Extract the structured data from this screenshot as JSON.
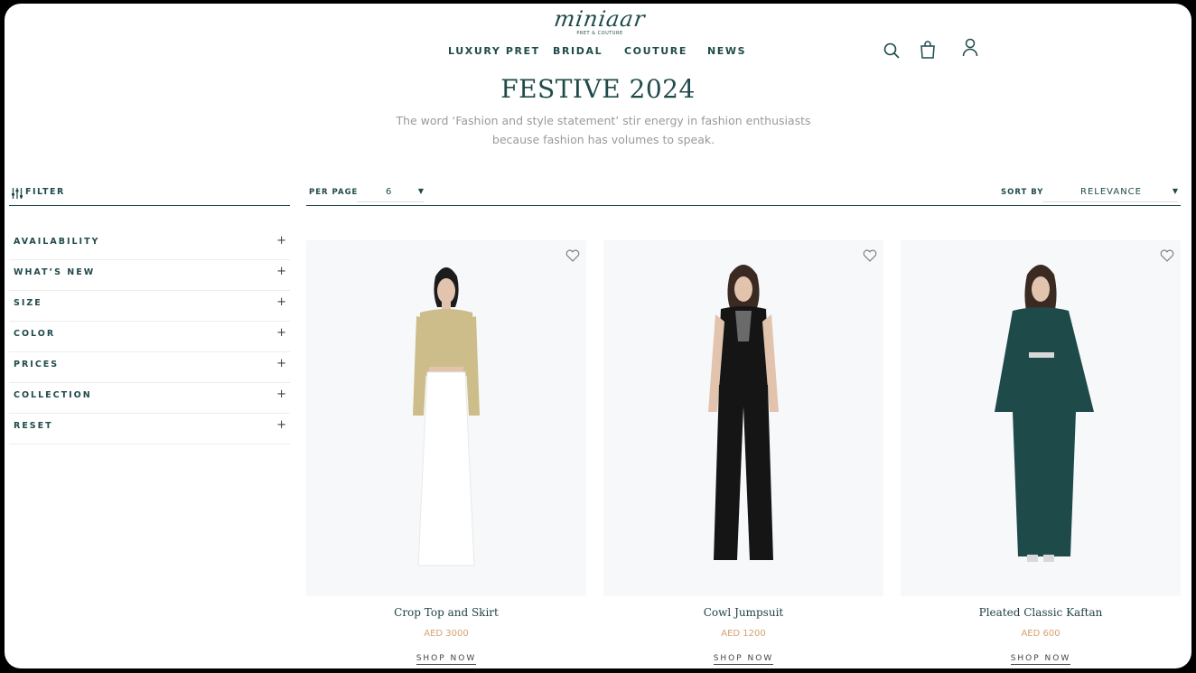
{
  "brand": {
    "logo": "miniaar",
    "tagline": "PRET & COUTURE"
  },
  "nav": [
    {
      "label": "LUXURY PRET"
    },
    {
      "label": "BRIDAL"
    },
    {
      "label": "COUTURE"
    },
    {
      "label": "NEWS"
    }
  ],
  "header_icons": [
    "search-icon",
    "shopping-bag-icon",
    "user-icon"
  ],
  "page": {
    "title": "FESTIVE 2024",
    "description_line1": "The word ‘Fashion and style statement’ stir energy in fashion enthusiasts",
    "description_line2": "because fashion has volumes to speak."
  },
  "filter": {
    "label": "FILTER",
    "items": [
      {
        "label": "AVAILABILITY"
      },
      {
        "label": "WHAT’S NEW"
      },
      {
        "label": "SIZE"
      },
      {
        "label": "COLOR"
      },
      {
        "label": "PRICES"
      },
      {
        "label": "COLLECTION"
      },
      {
        "label": "RESET"
      }
    ],
    "expand_symbol": "+"
  },
  "toolbar": {
    "per_page_label": "PER PAGE",
    "per_page_value": "6",
    "sort_label": "SORT BY",
    "sort_value": "RELEVANCE",
    "caret": "▼"
  },
  "products": [
    {
      "name": "Crop Top and Skirt",
      "price": "AED 3000",
      "cta": "SHOP NOW"
    },
    {
      "name": "Cowl Jumpsuit",
      "price": "AED 1200",
      "cta": "SHOP NOW"
    },
    {
      "name": "Pleated Classic Kaftan",
      "price": "AED 600",
      "cta": "SHOP NOW"
    }
  ],
  "colors": {
    "brand": "#1f4a4a",
    "price": "#d6a271",
    "muted": "#9a9a9a",
    "image_bg": "#f7f8fa"
  }
}
